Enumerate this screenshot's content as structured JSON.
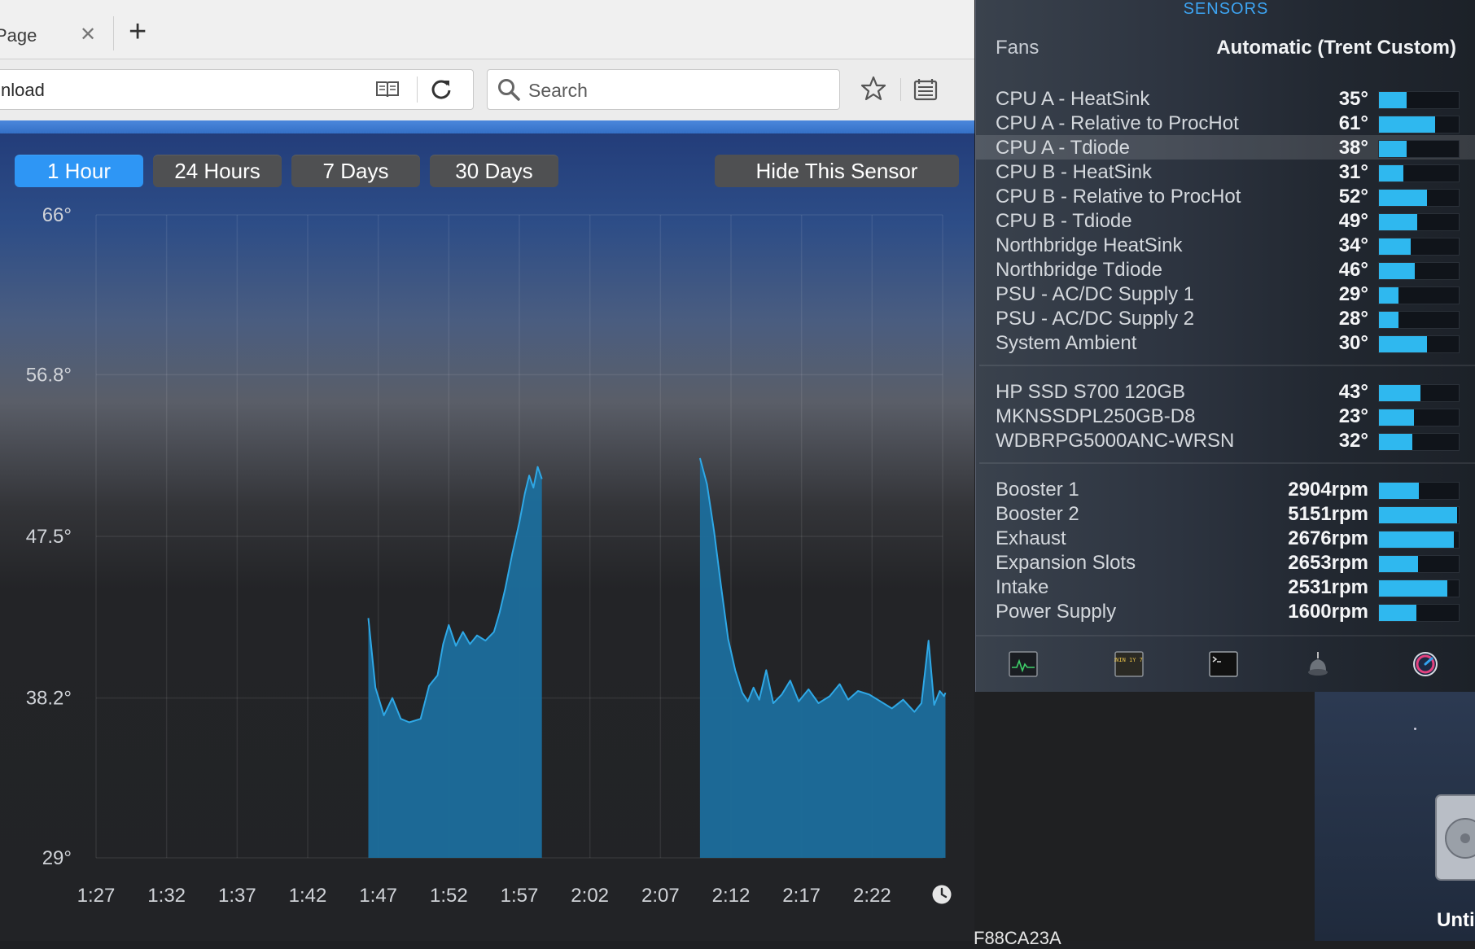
{
  "browser": {
    "tab_label": "Page",
    "url_text": "nload",
    "search_placeholder": "Search"
  },
  "ranges": {
    "one_hour": "1 Hour",
    "day": "24 Hours",
    "week": "7 Days",
    "month": "30 Days",
    "hide_sensor": "Hide This Sensor"
  },
  "chart_data": {
    "type": "area",
    "y_ticks": [
      "66°",
      "56.8°",
      "47.5°",
      "38.2°",
      "29°"
    ],
    "y_tick_values": [
      66,
      56.8,
      47.5,
      38.2,
      29
    ],
    "ylim": [
      29,
      66
    ],
    "x_ticks": [
      "1:27",
      "1:32",
      "1:37",
      "1:42",
      "1:47",
      "1:52",
      "1:57",
      "2:02",
      "2:07",
      "2:12",
      "2:17",
      "2:22"
    ],
    "x_minutes": [
      87,
      147
    ],
    "grid": true,
    "color": "#1c6e9c",
    "line_color": "#2fa8e6",
    "segments": [
      {
        "points": [
          [
            106.3,
            42.8
          ],
          [
            106.8,
            38.8
          ],
          [
            107.4,
            37.2
          ],
          [
            108.0,
            38.2
          ],
          [
            108.6,
            37.0
          ],
          [
            109.2,
            36.8
          ],
          [
            110.0,
            37.0
          ],
          [
            110.6,
            38.9
          ],
          [
            111.2,
            39.5
          ],
          [
            111.6,
            41.3
          ],
          [
            112.0,
            42.4
          ],
          [
            112.5,
            41.2
          ],
          [
            113.0,
            42.0
          ],
          [
            113.5,
            41.3
          ],
          [
            114.0,
            41.8
          ],
          [
            114.6,
            41.5
          ],
          [
            115.2,
            42.0
          ],
          [
            115.6,
            43.1
          ],
          [
            116.0,
            44.5
          ],
          [
            116.5,
            46.5
          ],
          [
            117.0,
            48.3
          ],
          [
            117.4,
            50.0
          ],
          [
            117.7,
            51.0
          ],
          [
            118.0,
            50.3
          ],
          [
            118.3,
            51.5
          ],
          [
            118.6,
            50.8
          ]
        ]
      },
      {
        "points": [
          [
            129.8,
            52.0
          ],
          [
            130.3,
            50.5
          ],
          [
            130.8,
            47.8
          ],
          [
            131.3,
            44.6
          ],
          [
            131.8,
            41.6
          ],
          [
            132.3,
            39.8
          ],
          [
            132.8,
            38.5
          ],
          [
            133.2,
            38.0
          ],
          [
            133.6,
            38.8
          ],
          [
            134.0,
            38.1
          ],
          [
            134.5,
            39.8
          ],
          [
            135.0,
            37.9
          ],
          [
            135.6,
            38.4
          ],
          [
            136.2,
            39.2
          ],
          [
            136.8,
            38.0
          ],
          [
            137.5,
            38.7
          ],
          [
            138.2,
            37.9
          ],
          [
            139.0,
            38.3
          ],
          [
            139.7,
            39.0
          ],
          [
            140.3,
            38.1
          ],
          [
            141.0,
            38.6
          ],
          [
            141.8,
            38.4
          ],
          [
            142.6,
            38.0
          ],
          [
            143.4,
            37.6
          ],
          [
            144.2,
            38.1
          ],
          [
            145.0,
            37.4
          ],
          [
            145.5,
            37.9
          ],
          [
            146.0,
            41.5
          ],
          [
            146.4,
            37.8
          ],
          [
            146.8,
            38.6
          ],
          [
            147.1,
            38.3
          ],
          [
            147.2,
            38.5
          ]
        ]
      }
    ]
  },
  "panel": {
    "title": "SENSORS",
    "fans_label": "Fans",
    "fans_value": "Automatic (Trent Custom)",
    "temps": [
      {
        "name": "CPU A - HeatSink",
        "value": "35°",
        "level": 0.35
      },
      {
        "name": "CPU A - Relative to ProcHot",
        "value": "61°",
        "level": 0.7
      },
      {
        "name": "CPU A - Tdiode",
        "value": "38°",
        "level": 0.35,
        "highlight": true
      },
      {
        "name": "CPU B - HeatSink",
        "value": "31°",
        "level": 0.31
      },
      {
        "name": "CPU B - Relative to ProcHot",
        "value": "52°",
        "level": 0.6
      },
      {
        "name": "CPU B - Tdiode",
        "value": "49°",
        "level": 0.48
      },
      {
        "name": "Northbridge HeatSink",
        "value": "34°",
        "level": 0.4
      },
      {
        "name": "Northbridge Tdiode",
        "value": "46°",
        "level": 0.45
      },
      {
        "name": "PSU - AC/DC Supply 1",
        "value": "29°",
        "level": 0.24
      },
      {
        "name": "PSU - AC/DC Supply 2",
        "value": "28°",
        "level": 0.24
      },
      {
        "name": "System Ambient",
        "value": "30°",
        "level": 0.6
      }
    ],
    "drives": [
      {
        "name": "HP SSD S700 120GB",
        "value": "43°",
        "level": 0.52
      },
      {
        "name": "MKNSSDPL250GB-D8",
        "value": "23°",
        "level": 0.44
      },
      {
        "name": "WDBRPG5000ANC-WRSN",
        "value": "32°",
        "level": 0.42
      }
    ],
    "fans": [
      {
        "name": "Booster 1",
        "value": "2904rpm",
        "level": 0.5
      },
      {
        "name": "Booster 2",
        "value": "5151rpm",
        "level": 0.98
      },
      {
        "name": "Exhaust",
        "value": "2676rpm",
        "level": 0.94
      },
      {
        "name": "Expansion Slots",
        "value": "2653rpm",
        "level": 0.49
      },
      {
        "name": "Intake",
        "value": "2531rpm",
        "level": 0.86
      },
      {
        "name": "Power Supply",
        "value": "1600rpm",
        "level": 0.47
      }
    ],
    "console_badge": "WARNIN\n1Y 7:36"
  },
  "desktop": {
    "left_text": "F88CA23A",
    "right_text": "Unti"
  },
  "icons": {
    "reader": "reader-view-icon",
    "reload": "reload-icon",
    "search": "search-icon",
    "star": "bookmark-star-icon",
    "library": "library-icon",
    "clock": "clock-icon",
    "activity": "activity-monitor-icon",
    "console": "console-icon",
    "terminal": "terminal-icon",
    "disk_utility": "disk-utility-icon",
    "istat": "istat-menus-icon",
    "disk": "hard-disk-icon"
  }
}
